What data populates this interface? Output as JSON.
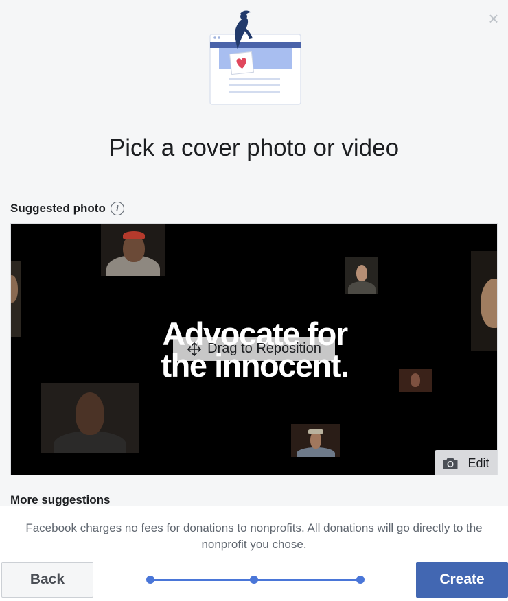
{
  "dialog": {
    "close_glyph": "×",
    "title": "Pick a cover photo or video"
  },
  "suggested": {
    "label": "Suggested photo",
    "info_glyph": "i",
    "headline_line1": "Advocate for",
    "headline_line2": "the innocent.",
    "drag_label": "Drag to Reposition",
    "edit_label": "Edit"
  },
  "more": {
    "label": "More suggestions"
  },
  "footer": {
    "fee_note": "Facebook charges no fees for donations to nonprofits. All donations will go directly to the nonprofit you chose.",
    "back_label": "Back",
    "create_label": "Create",
    "progress_steps": 3,
    "progress_current": 3
  },
  "colors": {
    "primary": "#4267b2",
    "progress": "#4a76d8",
    "heart": "#e0475c",
    "background": "#f5f6f7"
  },
  "icons": {
    "close": "close-icon",
    "info": "info-icon",
    "drag": "move-arrows-icon",
    "edit": "camera-icon"
  }
}
